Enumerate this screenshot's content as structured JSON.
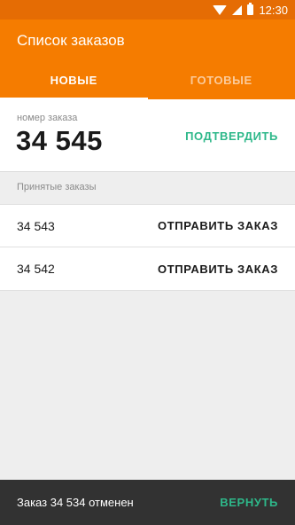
{
  "status_bar": {
    "time": "12:30",
    "icons": [
      "wifi-icon",
      "signal-icon",
      "battery-icon"
    ]
  },
  "app_bar": {
    "title": "Список заказов",
    "color": "#f57c00"
  },
  "tabs": [
    {
      "label": "НОВЫЕ",
      "active": true
    },
    {
      "label": "ГОТОВЫЕ",
      "active": false
    }
  ],
  "current_order": {
    "caption": "номер заказа",
    "number": "34 545",
    "confirm_label": "ПОДТВЕРДИТЬ"
  },
  "accepted_orders": {
    "header": "Принятые заказы",
    "items": [
      {
        "number": "34 543",
        "action": "ОТПРАВИТЬ ЗАКАЗ"
      },
      {
        "number": "34 542",
        "action": "ОТПРАВИТЬ ЗАКАЗ"
      }
    ]
  },
  "snackbar": {
    "message": "Заказ 34 534 отменен",
    "action": "ВЕРНУТЬ"
  },
  "colors": {
    "accent": "#2eb88a",
    "status_bar": "#e56c04"
  }
}
